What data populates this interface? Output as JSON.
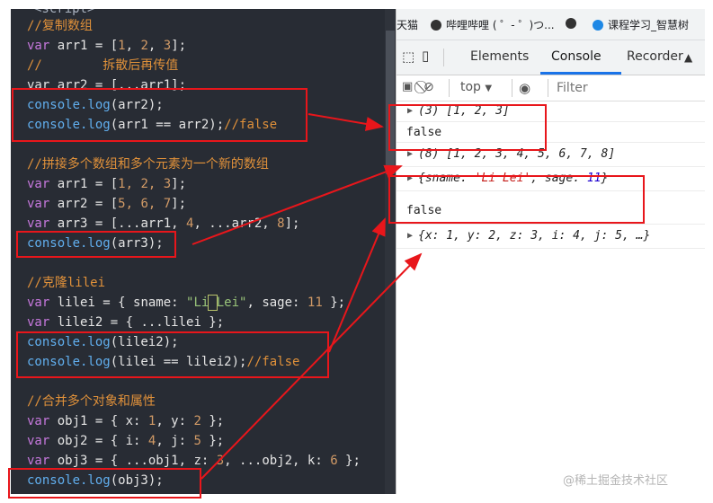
{
  "editor": {
    "top_tag": "<script>",
    "lines": {
      "l1": "//复制数组",
      "l2_kw": "var",
      "l2_id": " arr1 = [",
      "l2_n1": "1",
      "l2_n2": "2",
      "l2_n3": "3",
      "l2_end": "];",
      "l3": "//        拆散后再传值",
      "l4": "var arr2 = [...arr1];",
      "l5_fn": "console.log",
      "l5_arg": "(arr2);",
      "l6_fn": "console.log",
      "l6_arg": "(arr1 == arr2);",
      "l6_com": "//false",
      "l7": "//拼接多个数组和多个元素为一个新的数组",
      "l8_kw": "var",
      "l8_id": " arr1 = [",
      "l8_n": "1, 2, 3",
      "l8_end": "];",
      "l9_kw": "var",
      "l9_id": " arr2 = [",
      "l9_n": "5, 6, 7",
      "l9_end": "];",
      "l10_kw": "var",
      "l10_id": " arr3 = [...arr1, ",
      "l10_n1": "4",
      "l10_mid": ", ...arr2, ",
      "l10_n2": "8",
      "l10_end": "];",
      "l11_fn": "console.log",
      "l11_arg": "(arr3);",
      "l12": "//克隆lilei",
      "l13_kw": "var",
      "l13_id": " lilei = { sname: ",
      "l13_s1": "\"Li",
      "l13_s2": "Lei\"",
      "l13_mid": ", sage: ",
      "l13_n": "11",
      "l13_end": " };",
      "l14_kw": "var",
      "l14_id": " lilei2 = { ...lilei };",
      "l15_fn": "console.log",
      "l15_arg": "(lilei2);",
      "l16_fn": "console.log",
      "l16_arg": "(lilei == lilei2);",
      "l16_com": "//false",
      "l17": "//合并多个对象和属性",
      "l18_kw": "var",
      "l18_id": " obj1 = { x: ",
      "l18_n1": "1",
      "l18_mid": ", y: ",
      "l18_n2": "2",
      "l18_end": " };",
      "l19_kw": "var",
      "l19_id": " obj2 = { i: ",
      "l19_n1": "4",
      "l19_mid": ", j: ",
      "l19_n2": "5",
      "l19_end": " };",
      "l20_kw": "var",
      "l20_id": " obj3 = { ...obj1, z: ",
      "l20_n1": "3",
      "l20_mid": ", ...obj2, k: ",
      "l20_n2": "6",
      "l20_end": " };",
      "l21_fn": "console.log",
      "l21_arg": "(obj3);"
    }
  },
  "bookmarks": [
    {
      "label": "天猫"
    },
    {
      "label": "哔哩哔哩 ( ゜- ゜)つ..."
    },
    {
      "label": ""
    },
    {
      "label": "课程学习_智慧树"
    }
  ],
  "devtools": {
    "tabs": [
      "Elements",
      "Console",
      "Recorder"
    ],
    "active_tab": "Console",
    "context": "top",
    "filter_placeholder": "Filter"
  },
  "console": {
    "m1_count": "(3)",
    "m1_val": " [1, 2, 3]",
    "m2": "false",
    "m3_count": "(8)",
    "m3_val": " [1, 2, 3, 4, 5, 6, 7, 8]",
    "m4_a": "{sname: ",
    "m4_s": "'Li Lei'",
    "m4_b": ", sage: ",
    "m4_n": "11",
    "m4_c": "}",
    "m5": "false",
    "m6": "{x: 1, y: 2, z: 3, i: 4, j: 5, …}"
  },
  "watermark": "@稀土掘金技术社区",
  "colors": {
    "annotation": "#e8161b",
    "active_tab_underline": "#1a73e8"
  }
}
